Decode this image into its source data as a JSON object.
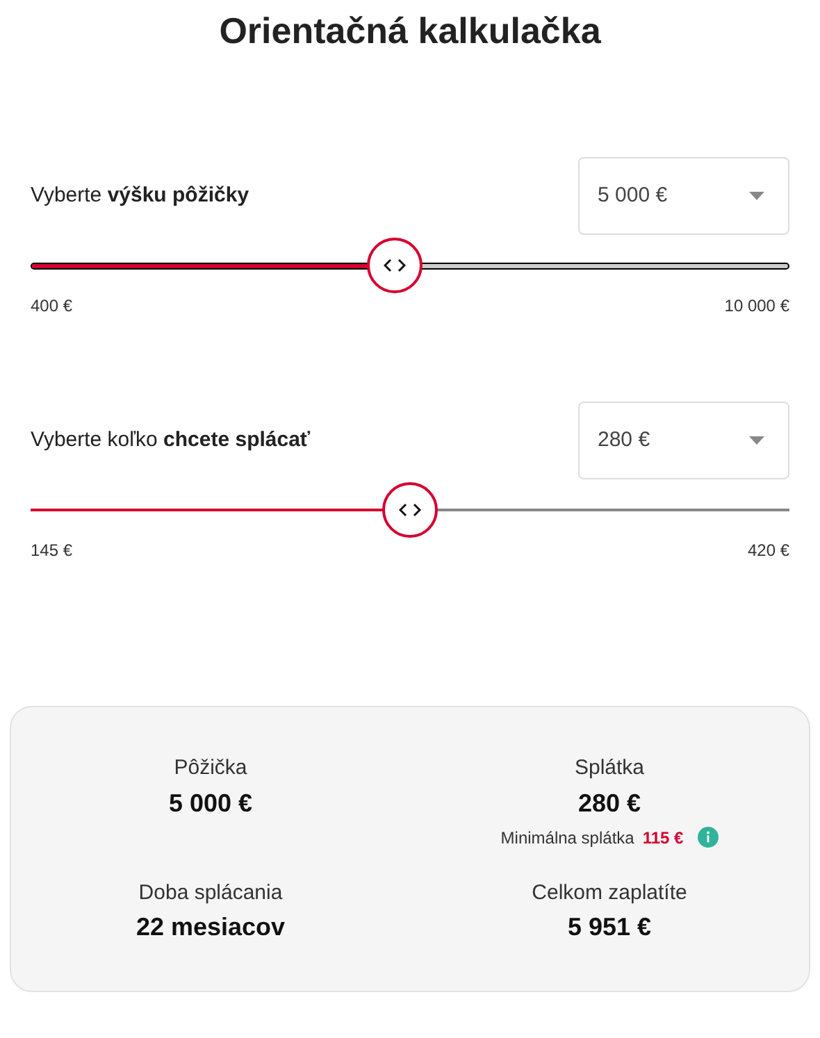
{
  "title": "Orientačná kalkulačka",
  "sliders": [
    {
      "kind": "bordered",
      "label": "Vyberte **výšku pôžičky**",
      "value": "5 000 €",
      "level": 0.48,
      "min": "400 €",
      "max": "10 000 €"
    },
    {
      "kind": "plain",
      "label": "Vyberte koľko **chcete splácať**",
      "value": "280 €",
      "level": 0.5,
      "min": "145 €",
      "max": "420 €"
    }
  ],
  "summary": [
    {
      "label": "Pôžička",
      "value": "5 000 €"
    },
    {
      "label": "Splátka",
      "value": "280 €",
      "note": {
        "label": "Minimálna splátka",
        "value": "115 €"
      }
    },
    {
      "label": "Doba splácania",
      "value": "22 mesiacov"
    },
    {
      "label": "Celkom zaplatíte",
      "value": "5 951 €"
    }
  ]
}
